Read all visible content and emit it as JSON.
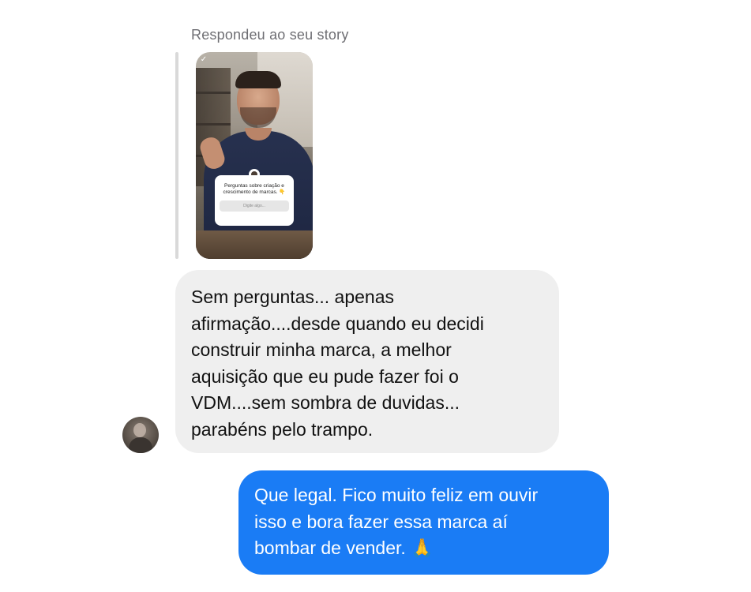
{
  "reply_context": {
    "label": "Respondeu ao seu story"
  },
  "story": {
    "question_text": "Perguntas sobre criação e crescimento de marcas. 👇",
    "input_placeholder": "Digite algo...",
    "check_icon": "checkmark-icon"
  },
  "messages": [
    {
      "direction": "received",
      "text": "Sem perguntas... apenas\nafirmação....desde quando eu decidi\nconstruir minha marca, a melhor\naquisição que eu pude fazer foi o\nVDM....sem sombra de duvidas...\nparabéns pelo trampo."
    },
    {
      "direction": "sent",
      "text": "Que legal. Fico muito feliz em ouvir\nisso e bora fazer essa marca aí\nbombar de vender. 🙏"
    }
  ],
  "colors": {
    "received_bubble": "#efefef",
    "sent_bubble": "#1a7cf5",
    "reply_label": "#6e6e73"
  }
}
